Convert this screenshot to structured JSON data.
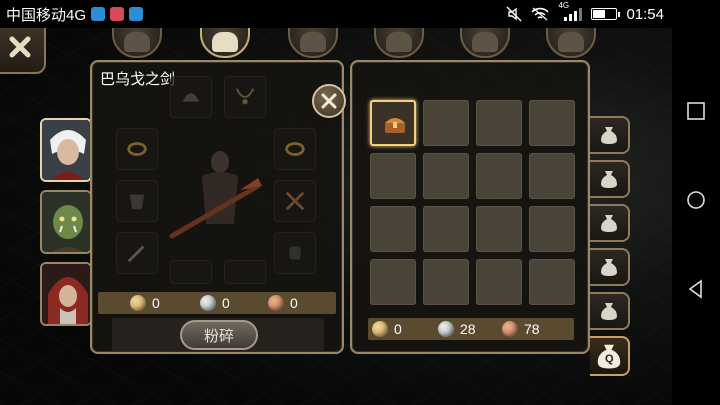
{
  "status_bar": {
    "carrier": "中国移动4G",
    "time": "01:54",
    "network": "4G",
    "battery_level": 0.55,
    "app_badges": [
      "#2a8fd8",
      "#d84a5a",
      "#2a8fd8"
    ]
  },
  "top_tabs": [
    "hero",
    "equip",
    "skill",
    "army",
    "quest",
    "settings"
  ],
  "active_top_tab": "equip",
  "heroes": [
    "white-haired-hero",
    "orc-hero",
    "red-hooded-hero"
  ],
  "item_panel": {
    "title": "巴乌戈之剑",
    "currencies": {
      "gold": "0",
      "silver": "0",
      "copper": "0"
    },
    "shatter_label": "粉碎"
  },
  "inventory": {
    "rows": 4,
    "cols": 4,
    "selected_index": 0,
    "items": [
      "treasure-chest"
    ],
    "currencies": {
      "gold": "0",
      "silver": "28",
      "copper": "78"
    }
  },
  "bag_tabs": {
    "count": 6,
    "active_label": "Q"
  },
  "colors": {
    "panel_border": "#9a8866",
    "accent_gold": "#f2d27e",
    "currency_bar": "#5a4a30"
  }
}
